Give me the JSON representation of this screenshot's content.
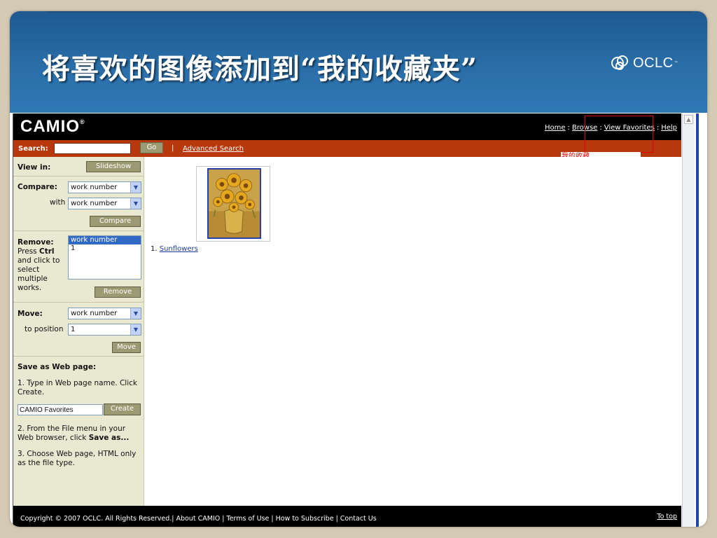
{
  "slide": {
    "title": "将喜欢的图像添加到“我的收藏夹”",
    "brand": "OCLC",
    "brand_tm": "™"
  },
  "app": {
    "logo": "CAMIO",
    "logo_mark": "®",
    "nav": [
      {
        "label": "Home"
      },
      {
        "label": "Browse"
      },
      {
        "label": "View Favorites"
      },
      {
        "label": "Help"
      }
    ],
    "nav_sep": ":",
    "annotation": "我的收藏",
    "search": {
      "label": "Search:",
      "value": "",
      "go_label": "Go",
      "pipe": "|",
      "advanced_label": "Advanced Search"
    },
    "sidebar": {
      "view_in_label": "View in:",
      "slideshow_label": "Slideshow",
      "compare_label": "Compare:",
      "compare_value": "work number",
      "with_label": "with",
      "with_value": "work number",
      "compare_button": "Compare",
      "remove_label": "Remove:",
      "remove_instr_prefix": "Press",
      "remove_instr_key": "Ctrl",
      "remove_instr_rest": "and click to select multiple works.",
      "remove_options": [
        "work number",
        "1"
      ],
      "remove_button": "Remove",
      "move_label": "Move:",
      "move_value": "work number",
      "to_position_label": "to position",
      "to_position_value": "1",
      "move_button": "Move",
      "save_title": "Save as Web page:",
      "save_step1": "1. Type in Web page name. Click Create.",
      "web_name_value": "CAMIO Favorites",
      "create_button": "Create",
      "save_step2_prefix": "2. From the File menu in your Web browser, click",
      "save_step2_bold": "Save as...",
      "save_step3": "3. Choose Web page, HTML only as the file type."
    },
    "results": [
      {
        "index": "1.",
        "title": "Sunflowers"
      }
    ],
    "footer": {
      "text": "Copyright © 2007 OCLC. All Rights Reserved.| About CAMIO | Terms of Use | How to Subscribe | Contact Us",
      "to_top": "To top"
    },
    "colors": {
      "search_bar": "#b8380d",
      "sidebar": "#e9e8d0",
      "button": "#9c9a72",
      "header_blue": "#2a6ea8",
      "annotation_red": "#e00000"
    }
  }
}
